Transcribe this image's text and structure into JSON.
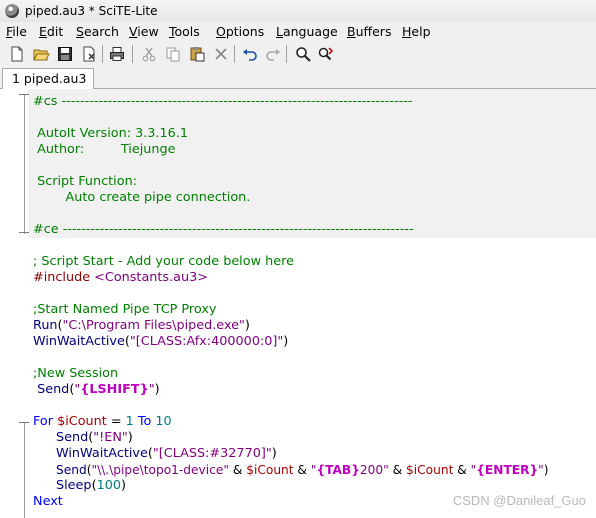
{
  "window": {
    "title": "piped.au3 * SciTE-Lite"
  },
  "menubar": [
    {
      "mn": "F",
      "rest": "ile"
    },
    {
      "mn": "E",
      "rest": "dit"
    },
    {
      "mn": "S",
      "rest": "earch"
    },
    {
      "mn": "V",
      "rest": "iew"
    },
    {
      "mn": "T",
      "rest": "ools"
    },
    {
      "mn": "O",
      "rest": "ptions"
    },
    {
      "mn": "L",
      "rest": "anguage"
    },
    {
      "mn": "B",
      "rest": "uffers"
    },
    {
      "mn": "H",
      "rest": "elp"
    }
  ],
  "toolbar_icons": [
    "new-file-icon",
    "open-folder-icon",
    "save-icon",
    "close-file-icon",
    "print-icon",
    "cut-icon",
    "copy-icon",
    "paste-icon",
    "delete-icon",
    "undo-icon",
    "redo-icon",
    "find-icon",
    "find-replace-icon"
  ],
  "tab": {
    "label": "1 piped.au3 *"
  },
  "code": {
    "cs_open_a": "#cs ",
    "cs_open_b": "----------------------------------------------------------------------------",
    "version": " AutoIt Version: 3.3.16.1",
    "author": " Author:         Tiejunge",
    "script_function": " Script Function:",
    "function_desc": "\tAuto create pipe connection.",
    "ce_a": "#ce ",
    "ce_b": "----------------------------------------------------------------------------",
    "script_start": "; Script Start - Add your code below here",
    "include_kw": "#include ",
    "include_file": "<Constants.au3>",
    "proxy_comment": ";Start Named Pipe TCP Proxy",
    "run_fn": "Run",
    "run_open": "(",
    "run_arg": "\"C:\\Program Files\\piped.exe\"",
    "run_close": ")",
    "wait1_fn": "WinWaitActive",
    "wait1_open": "(",
    "wait1_arg": "\"[CLASS:Afx:400000:0]\"",
    "wait1_close": ")",
    "session_comment": ";New Session",
    "send1_fn": " Send",
    "send1_open": "(",
    "send1_q1": "\"",
    "send1_key": "{LSHIFT}",
    "send1_q2": "\"",
    "send1_close": ")",
    "for_kw": "For ",
    "for_var": "$iCount",
    "for_eq": " = ",
    "for_from": "1",
    "for_to_kw": " To ",
    "for_to": "10",
    "send2_fn": "Send",
    "send2_open": "(",
    "send2_arg": "\"!EN\"",
    "send2_close": ")",
    "wait2_fn": "WinWaitActive",
    "wait2_open": "(",
    "wait2_arg": "\"[CLASS:#32770]\"",
    "wait2_close": ")",
    "send3_fn": "Send",
    "send3_open": "(",
    "send3_s1": "\"\\\\.\\pipe\\topo1-device\"",
    "send3_amp1": " & ",
    "send3_var1": "$iCount",
    "send3_amp2": " & ",
    "send3_q1": "\"",
    "send3_key1": "{TAB}",
    "send3_s2": "200\"",
    "send3_amp3": " & ",
    "send3_var2": "$iCount",
    "send3_amp4": " & ",
    "send3_q2": "\"",
    "send3_key2": "{ENTER}",
    "send3_q3": "\"",
    "send3_close": ")",
    "sleep_fn": "Sleep",
    "sleep_open": "(",
    "sleep_arg": "100",
    "sleep_close": ")",
    "next_kw": "Next"
  },
  "watermark": "CSDN @Danileaf_Guo"
}
